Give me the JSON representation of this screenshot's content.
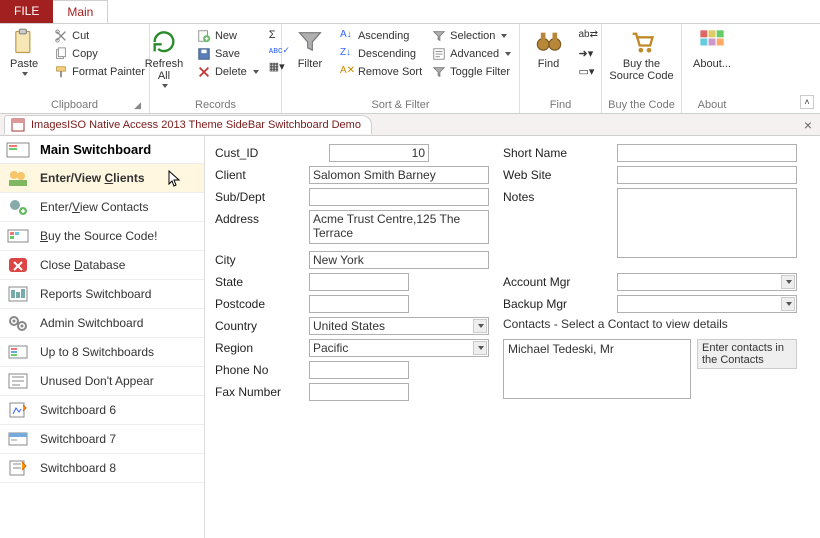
{
  "tabs": {
    "file": "FILE",
    "main": "Main"
  },
  "ribbon": {
    "clipboard": {
      "label": "Clipboard",
      "paste": "Paste",
      "cut": "Cut",
      "copy": "Copy",
      "format_painter": "Format Painter"
    },
    "records": {
      "label": "Records",
      "refresh": "Refresh All",
      "new": "New",
      "save": "Save",
      "delete": "Delete"
    },
    "sortfilter": {
      "label": "Sort & Filter",
      "filter": "Filter",
      "ascending": "Ascending",
      "descending": "Descending",
      "remove_sort": "Remove Sort",
      "selection": "Selection",
      "advanced": "Advanced",
      "toggle": "Toggle Filter"
    },
    "find": {
      "label": "Find",
      "find": "Find"
    },
    "buycode": {
      "label": "Buy the Code",
      "buy": "Buy the Source Code"
    },
    "about": {
      "label": "About",
      "about": "About..."
    }
  },
  "doc_tab": "ImagesISO Native Access 2013 Theme SideBar Switchboard Demo",
  "sidebar": {
    "title": "Main Switchboard",
    "items": [
      {
        "label_pre": "Enter/View ",
        "key": "C",
        "label_post": "lients"
      },
      {
        "label_pre": "Enter/",
        "key": "V",
        "label_post": "iew Contacts"
      },
      {
        "label_pre": "",
        "key": "B",
        "label_post": "uy the Source Code!"
      },
      {
        "label_pre": "Close ",
        "key": "D",
        "label_post": "atabase"
      },
      {
        "label_pre": "Reports Switchboard",
        "key": "",
        "label_post": ""
      },
      {
        "label_pre": "Admin Switchboard",
        "key": "",
        "label_post": ""
      },
      {
        "label_pre": "Up to 8 Switchboards",
        "key": "",
        "label_post": ""
      },
      {
        "label_pre": "Unused Don't Appear",
        "key": "",
        "label_post": ""
      },
      {
        "label_pre": "Switchboard 6",
        "key": "",
        "label_post": ""
      },
      {
        "label_pre": "Switchboard 7",
        "key": "",
        "label_post": ""
      },
      {
        "label_pre": "Switchboard 8",
        "key": "",
        "label_post": ""
      }
    ]
  },
  "form": {
    "labels": {
      "cust_id": "Cust_ID",
      "client": "Client",
      "sub_dept": "Sub/Dept",
      "address": "Address",
      "city": "City",
      "state": "State",
      "postcode": "Postcode",
      "country": "Country",
      "region": "Region",
      "phone": "Phone No",
      "fax": "Fax Number",
      "short_name": "Short Name",
      "web_site": "Web Site",
      "notes": "Notes",
      "account_mgr": "Account Mgr",
      "backup_mgr": "Backup Mgr"
    },
    "values": {
      "cust_id": "10",
      "client": "Salomon Smith Barney",
      "sub_dept": "",
      "address": "Acme Trust Centre,125 The Terrace",
      "city": "New York",
      "state": "",
      "postcode": "",
      "country": "United States",
      "region": "Pacific",
      "phone": "",
      "fax": "",
      "short_name": "",
      "web_site": "",
      "notes": "",
      "account_mgr": "",
      "backup_mgr": ""
    },
    "contacts_header": "Contacts - Select a Contact to view details",
    "contacts_selected": "Michael Tedeski, Mr",
    "contacts_hint": "Enter contacts in the Contacts"
  }
}
